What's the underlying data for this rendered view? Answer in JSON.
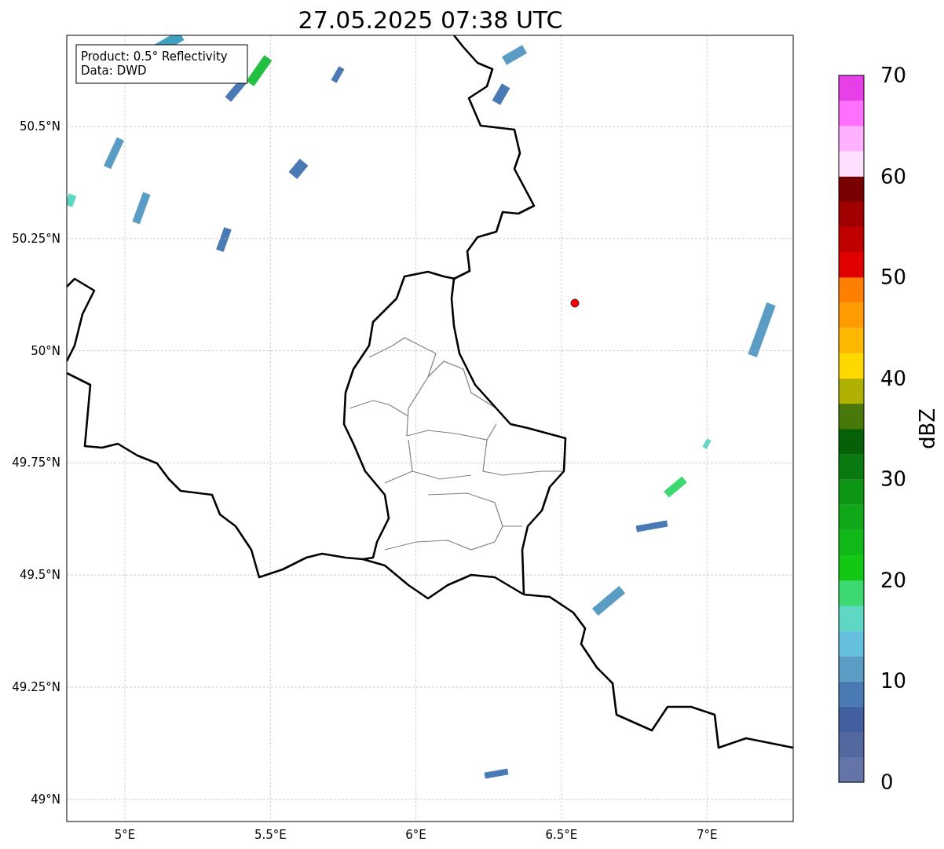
{
  "title": "27.05.2025 07:38 UTC",
  "info_box": {
    "lines": [
      "Product: 0.5° Reflectivity",
      "Data: DWD"
    ]
  },
  "map": {
    "y_ticks": [
      "50.5°N",
      "50.25°N",
      "50°N",
      "49.75°N",
      "49.5°N",
      "49.25°N",
      "49°N"
    ],
    "x_ticks": [
      "5°E",
      "5.5°E",
      "6°E",
      "6.5°E",
      "7°E"
    ]
  },
  "colorbar": {
    "label": "dBZ",
    "ticks": [
      "70",
      "60",
      "50",
      "40",
      "30",
      "20",
      "10",
      "0"
    ],
    "segments": [
      {
        "color": "#6474a8"
      },
      {
        "color": "#5468a0"
      },
      {
        "color": "#4260a0"
      },
      {
        "color": "#4a7ab4"
      },
      {
        "color": "#5a9cc4"
      },
      {
        "color": "#64c0dc"
      },
      {
        "color": "#5ed8c4"
      },
      {
        "color": "#3cd870"
      },
      {
        "color": "#12c812"
      },
      {
        "color": "#10b818"
      },
      {
        "color": "#10a818"
      },
      {
        "color": "#0c9614"
      },
      {
        "color": "#0a7a10"
      },
      {
        "color": "#066008"
      },
      {
        "color": "#48780a"
      },
      {
        "color": "#b0b000"
      },
      {
        "color": "#ffd800"
      },
      {
        "color": "#ffb800"
      },
      {
        "color": "#ff9c00"
      },
      {
        "color": "#ff8000"
      },
      {
        "color": "#e00000"
      },
      {
        "color": "#c00000"
      },
      {
        "color": "#a00000"
      },
      {
        "color": "#780000"
      },
      {
        "color": "#ffe0ff"
      },
      {
        "color": "#ffb0ff"
      },
      {
        "color": "#ff70ff"
      },
      {
        "color": "#e840e8"
      }
    ]
  }
}
